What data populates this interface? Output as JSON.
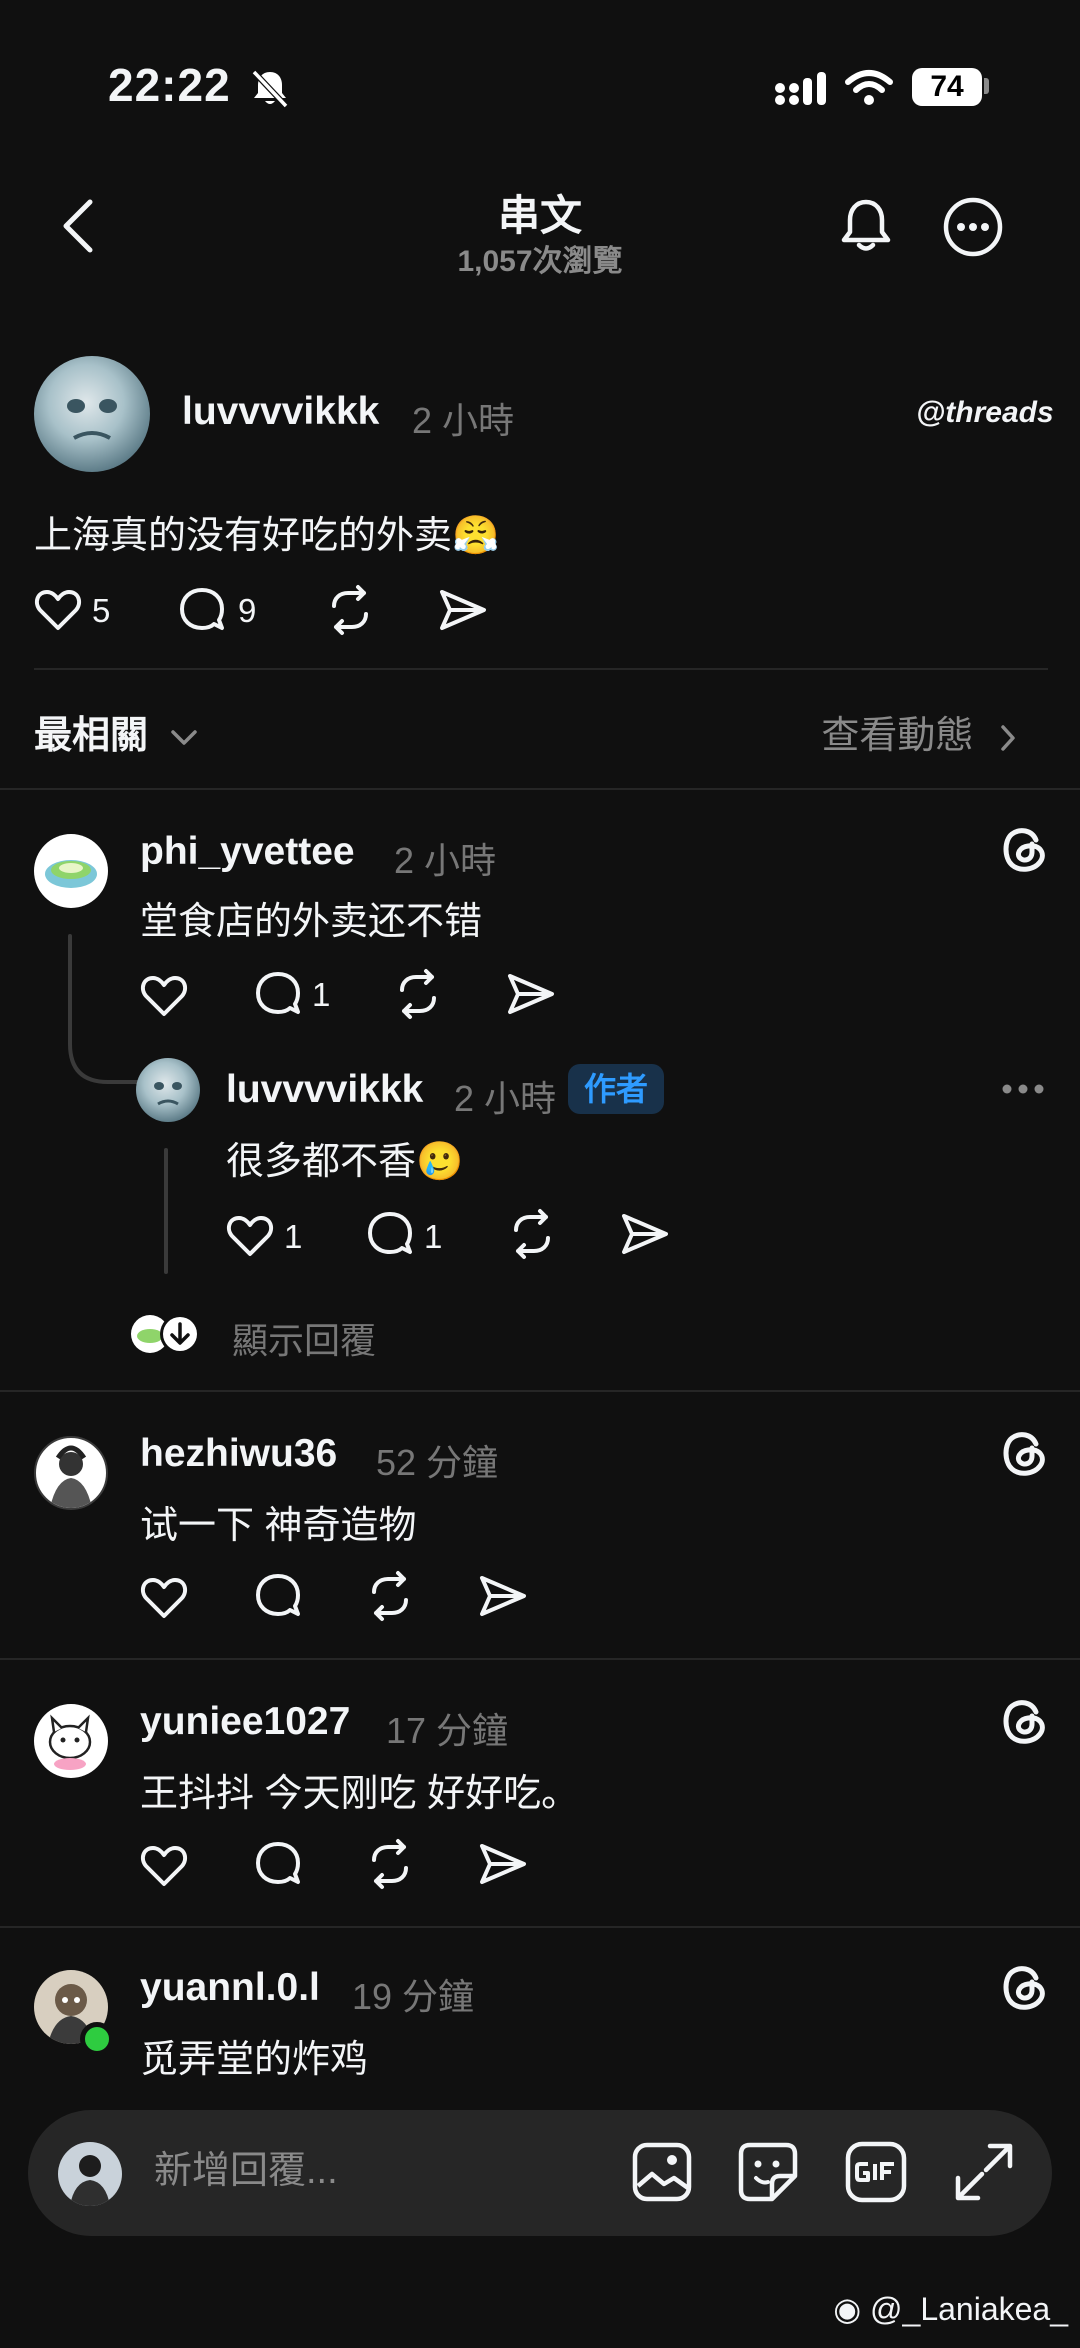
{
  "status_bar": {
    "time": "22:22",
    "battery": "74"
  },
  "header": {
    "title": "串文",
    "views": "1,057次瀏覽"
  },
  "post": {
    "username": "luvvvvikkk",
    "time": "2 小時",
    "brand": "threads",
    "text": "上海真的没有好吃的外卖😤",
    "likes": "5",
    "replies": "9"
  },
  "sort": {
    "label": "最相關",
    "activity": "查看動態"
  },
  "comments": [
    {
      "username": "phi_yvettee",
      "time": "2 小時",
      "text": "堂食店的外卖还不错",
      "likes": "",
      "replies": "1"
    },
    {
      "username": "luvvvvikkk",
      "time": "2 小時",
      "badge": "作者",
      "text": "很多都不香🥲",
      "likes": "1",
      "replies": "1"
    },
    {
      "username": "hezhiwu36",
      "time": "52 分鐘",
      "text": "试一下 神奇造物"
    },
    {
      "username": "yuniee1027",
      "time": "17 分鐘",
      "text": "王抖抖 今天刚吃 好好吃。"
    },
    {
      "username": "yuannl.0.l",
      "time": "19 分鐘",
      "text": "觅弄堂的炸鸡"
    }
  ],
  "show_replies": "顯示回覆",
  "composer": {
    "placeholder": "新增回覆..."
  },
  "watermark": "@_Laniakea_",
  "colors": {
    "background": "#101010",
    "text": "#f3f5f7",
    "secondary": "#777777",
    "accent_blue": "#2e9bff",
    "online_green": "#2ecc40"
  }
}
